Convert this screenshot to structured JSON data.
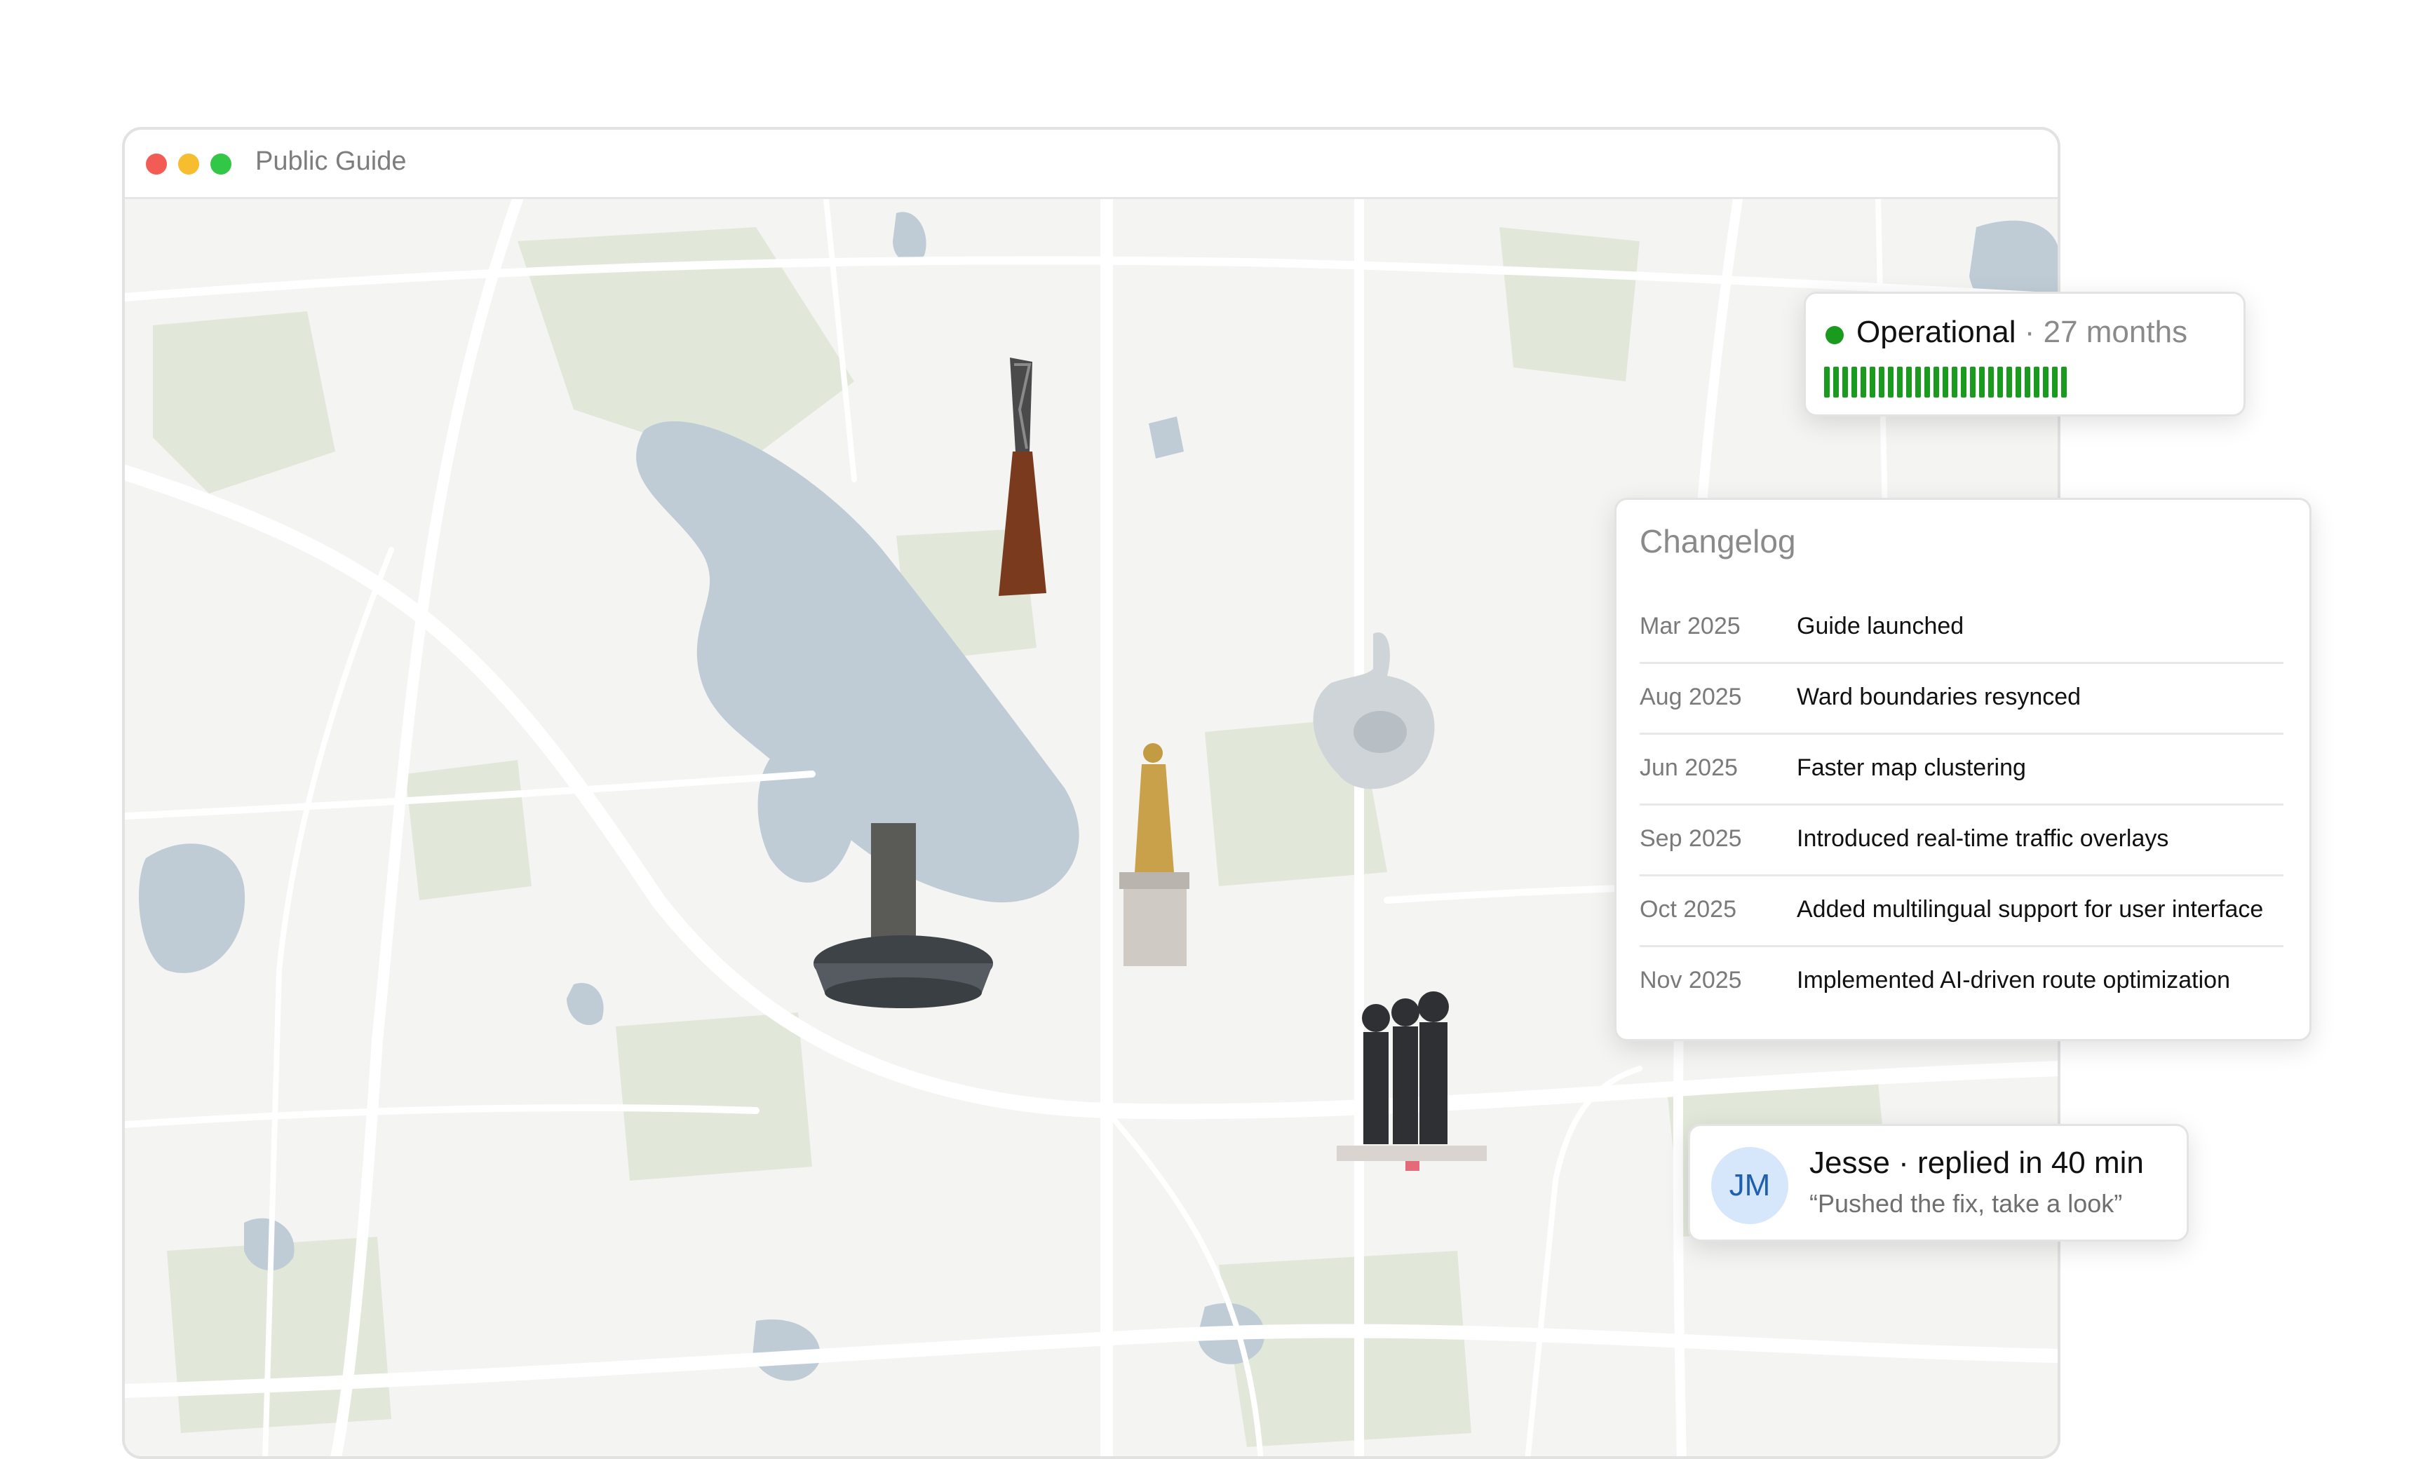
{
  "window": {
    "title": "Public Guide"
  },
  "status": {
    "label": "Operational",
    "separator": "·",
    "duration": "27 months",
    "uptime_bars": 27,
    "color": "#1a9a1f"
  },
  "changelog": {
    "title": "Changelog",
    "entries": [
      {
        "date": "Mar 2025",
        "text": "Guide launched"
      },
      {
        "date": "Aug 2025",
        "text": "Ward boundaries resynced"
      },
      {
        "date": "Jun 2025",
        "text": "Faster map clustering"
      },
      {
        "date": "Sep 2025",
        "text": "Introduced real-time traffic overlays"
      },
      {
        "date": "Oct 2025",
        "text": "Added multilingual support for user interface"
      },
      {
        "date": "Nov 2025",
        "text": "Implemented AI-driven route optimization"
      }
    ]
  },
  "reply": {
    "initials": "JM",
    "headline": "Jesse · replied in 40 min",
    "message": "“Pushed the fix, take a look”"
  },
  "map": {
    "water_color": "#bfccd6",
    "park_color": "#e1e8da",
    "road_color": "#ffffff"
  }
}
